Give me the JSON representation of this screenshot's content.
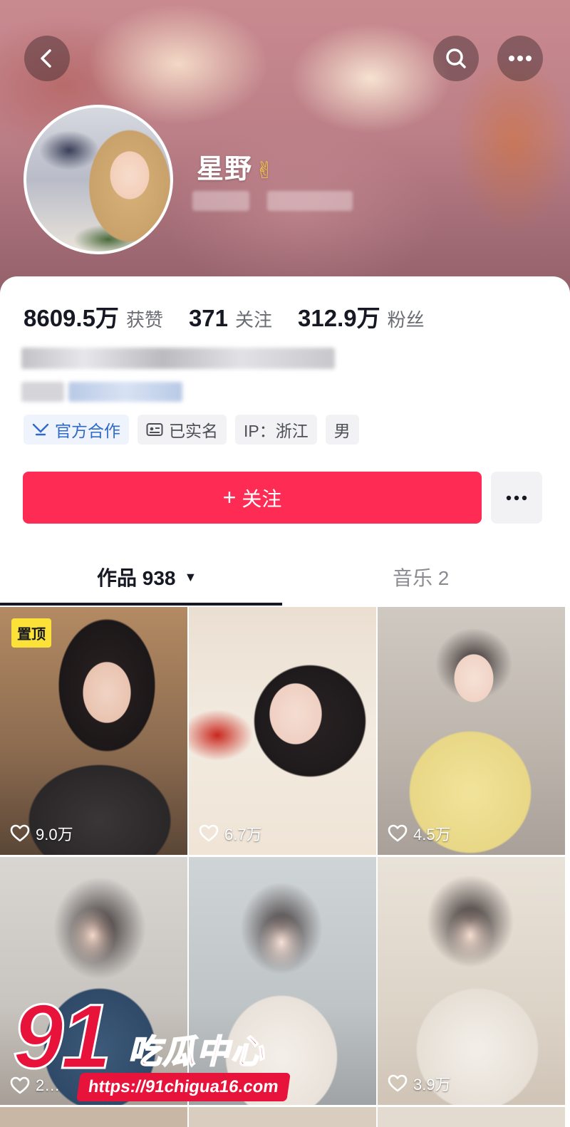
{
  "header": {
    "back_icon": "chevron-left-icon",
    "search_icon": "search-icon",
    "more_icon": "more-horizontal-icon"
  },
  "profile": {
    "name": "星野",
    "name_emoji": "✌",
    "stats": [
      {
        "value": "8609.5万",
        "label": "获赞"
      },
      {
        "value": "371",
        "label": "关注"
      },
      {
        "value": "312.9万",
        "label": "粉丝"
      }
    ],
    "tags": [
      {
        "label": "官方合作",
        "icon": "official-badge-icon"
      },
      {
        "label": "已实名",
        "icon": "id-card-icon"
      },
      {
        "label": "IP：浙江"
      },
      {
        "label": "男"
      }
    ]
  },
  "actions": {
    "follow_label": "关注",
    "follow_prefix": "+",
    "more_icon": "more-horizontal-icon"
  },
  "tabs": [
    {
      "label": "作品 938",
      "active": true,
      "caret": "▼"
    },
    {
      "label": "音乐 2",
      "active": false
    }
  ],
  "videos": [
    {
      "likes": "9.0万",
      "pinned": true,
      "pinned_label": "置顶"
    },
    {
      "likes": "6.7万",
      "pinned": false
    },
    {
      "likes": "4.5万",
      "pinned": false
    },
    {
      "likes": "2…",
      "pinned": false
    },
    {
      "likes": "",
      "pinned": false
    },
    {
      "likes": "3.9万",
      "pinned": false
    }
  ],
  "watermark": {
    "number": "91",
    "text": "吃瓜中心",
    "url": "https://91chigua16.com"
  },
  "colors": {
    "follow_button": "#fe2c55",
    "official_tag": "#2f6ac9",
    "pin_badge": "#fce138",
    "watermark": "#e8133a"
  }
}
